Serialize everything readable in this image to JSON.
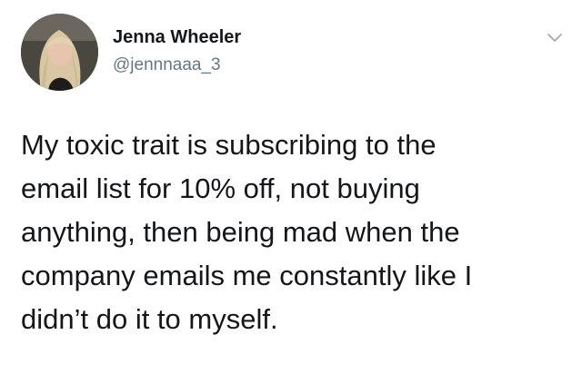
{
  "tweet": {
    "author": {
      "name": "Jenna Wheeler",
      "handle": "@jennnaaa_3",
      "avatar_icon": "profile-photo"
    },
    "menu_icon": "chevron-down-icon",
    "text_lines": [
      "My toxic trait is subscribing to the",
      "email list for 10% off, not buying",
      "anything, then being mad when the",
      "company emails me constantly like I",
      "didn’t do it to myself."
    ]
  }
}
